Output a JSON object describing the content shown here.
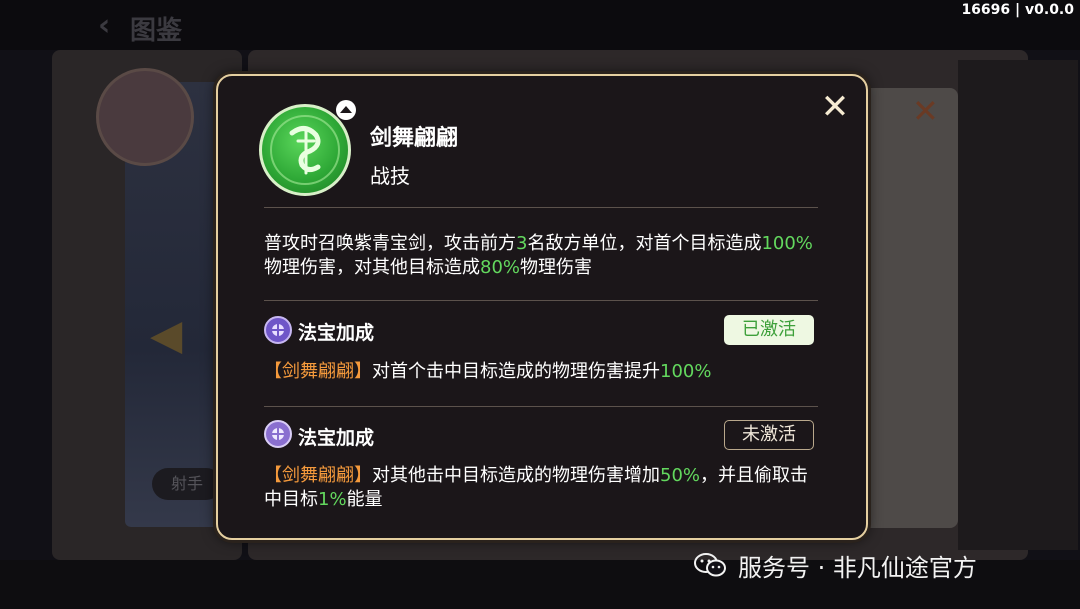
{
  "header": {
    "back_title": "图鉴"
  },
  "version": "16696 | v0.0.0",
  "background": {
    "role_label": "射手"
  },
  "skill": {
    "name": "剑舞翩翩",
    "type": "战技",
    "desc_parts": [
      "普攻时召唤紫青宝剑，攻击前方",
      "3",
      "名敌方单位，对首个目标造成",
      "100%",
      "物理伤害，对其他目标造成",
      "80%",
      "物理伤害"
    ]
  },
  "bonuses": [
    {
      "title": "法宝加成",
      "status": "已激活",
      "text_parts": [
        "【剑舞翩翩】",
        "对首个击中目标造成的物理伤害提升",
        "100%"
      ]
    },
    {
      "title": "法宝加成",
      "status": "未激活",
      "text_parts": [
        "【剑舞翩翩】",
        "对其他击中目标造成的物理伤害增加",
        "50%",
        "，并且偷取击中目标",
        "1%",
        "能量"
      ]
    }
  ],
  "watermark": {
    "text": "服务号 · 非凡仙途官方"
  },
  "colors": {
    "highlight_number": "#63d85e",
    "tag_orange": "#f59a3c",
    "modal_border": "#e5cfa0"
  },
  "icons": {
    "close": "close-icon",
    "skill": "sword-dance-skill-icon",
    "bonus": "treasure-bonus-icon",
    "watermark": "wechat-icon"
  }
}
